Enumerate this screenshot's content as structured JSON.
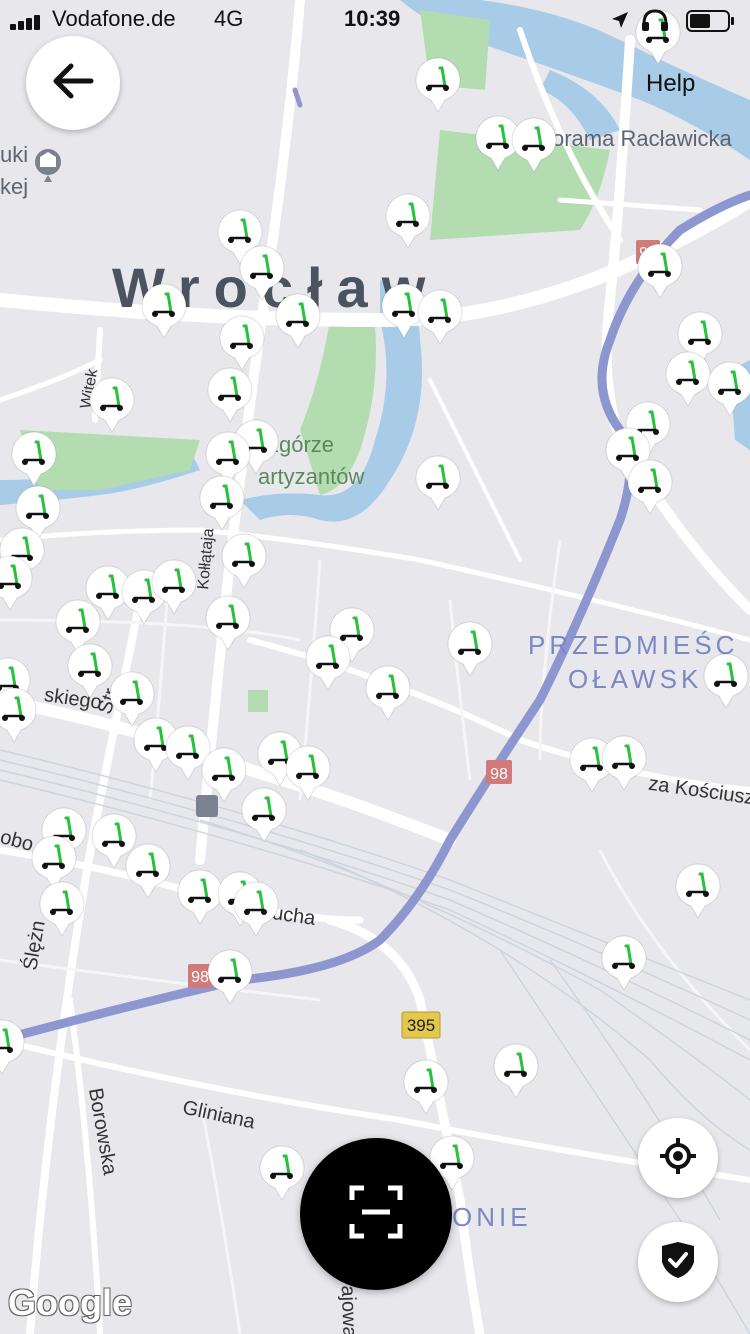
{
  "status_bar": {
    "carrier": "Vodafone.de",
    "network": "4G",
    "time": "10:39"
  },
  "header": {
    "back_icon": "arrow-left-icon",
    "help_label": "Help"
  },
  "map": {
    "city_label": "Wrocław",
    "district_labels": [
      "PRZEDMIEŚC",
      "OŁAWSK",
      "ONIE"
    ],
    "poi_labels": [
      "zgórze",
      "artyzantów",
      "orama Racławicka",
      "uki",
      "kej"
    ],
    "street_labels": [
      "Gliniana",
      "Borowska",
      "Ślężn",
      "ajowa",
      "ucha",
      "skiego",
      "Str",
      "Kołłątaja",
      "obo",
      "za Kościusz",
      "Witek"
    ],
    "route_badges": [
      "98",
      "98",
      "98",
      "395"
    ],
    "attribution": "Google"
  },
  "controls": {
    "locate_icon": "crosshair-icon",
    "safety_icon": "shield-check-icon",
    "scan_icon": "scan-frame-icon"
  },
  "colors": {
    "map_bg": "#e8e8ec",
    "water": "#a8cbe8",
    "park": "#b3dcb0",
    "major_road": "#ffffff",
    "rail_route": "#8d96cf",
    "scooter_green": "#25c23a",
    "scan_button": "#000000"
  }
}
